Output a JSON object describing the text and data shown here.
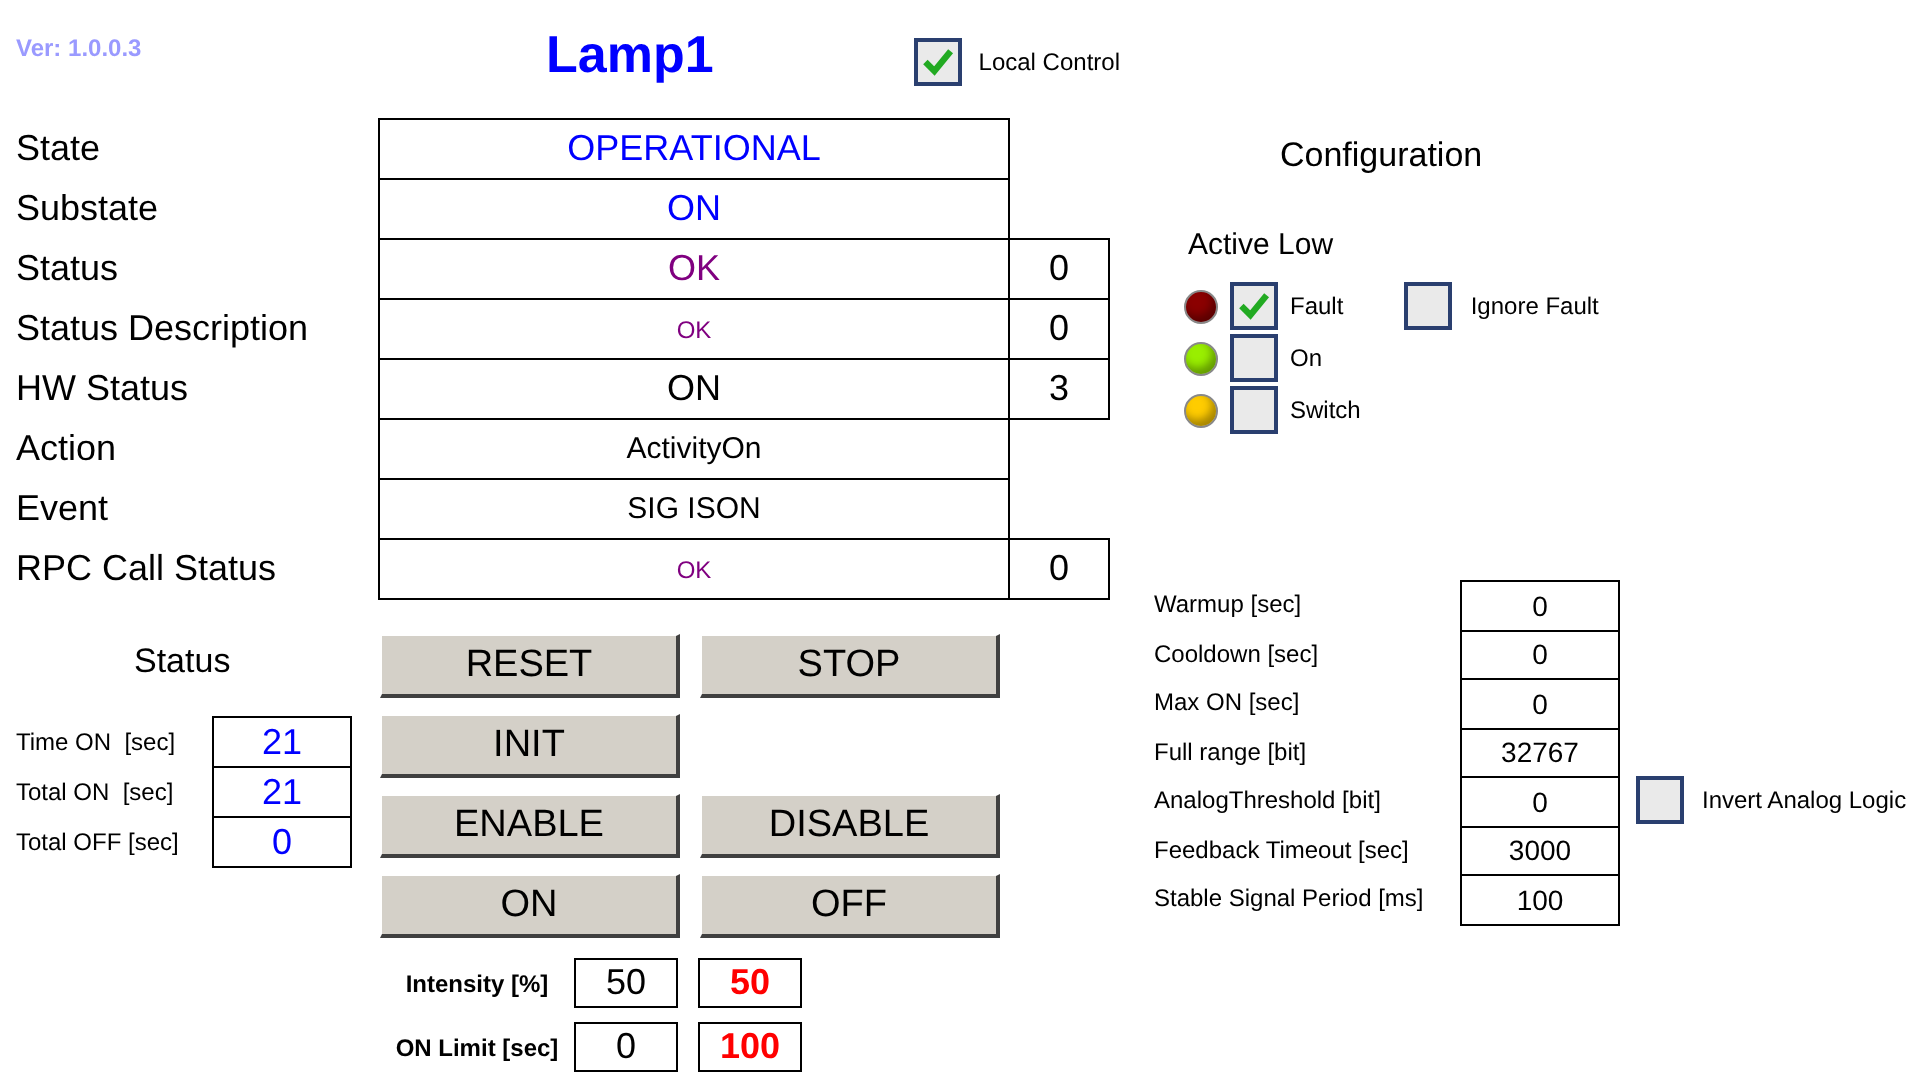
{
  "version": "Ver: 1.0.0.3",
  "title": "Lamp1",
  "local_control": {
    "label": "Local Control",
    "checked": true
  },
  "state_table": [
    {
      "label": "State",
      "value": "OPERATIONAL",
      "color": "#0000ff",
      "kind": "large"
    },
    {
      "label": "Substate",
      "value": "ON",
      "color": "#0000ff",
      "kind": "large"
    },
    {
      "label": "Status",
      "value": "OK",
      "color": "#800080",
      "kind": "large",
      "extra": "0"
    },
    {
      "label": "Status Description",
      "value": "OK",
      "color": "#800080",
      "kind": "small",
      "extra": "0"
    },
    {
      "label": "HW Status",
      "value": "ON",
      "color": "#000000",
      "kind": "large",
      "extra": "3"
    },
    {
      "label": "Action",
      "value": "ActivityOn",
      "color": "#000000",
      "kind": "medium"
    },
    {
      "label": "Event",
      "value": "SIG ISON",
      "color": "#000000",
      "kind": "medium"
    },
    {
      "label": "RPC Call Status",
      "value": "OK",
      "color": "#800080",
      "kind": "small",
      "extra": "0"
    }
  ],
  "configuration": {
    "title": "Configuration",
    "active_low_title": "Active Low",
    "signals": [
      {
        "label": "Fault",
        "color": "#8b0000",
        "checked": true
      },
      {
        "label": "On",
        "color": "#99ee00",
        "checked": false
      },
      {
        "label": "Switch",
        "color": "#ffcc00",
        "checked": false
      }
    ],
    "ignore_fault": {
      "label": "Ignore Fault",
      "checked": false
    }
  },
  "status": {
    "title": "Status",
    "counters": [
      {
        "label": "Time ON  [sec]",
        "value": "21"
      },
      {
        "label": "Total ON  [sec]",
        "value": "21"
      },
      {
        "label": "Total OFF [sec]",
        "value": "0"
      }
    ]
  },
  "buttons": [
    [
      "RESET",
      "STOP"
    ],
    [
      "INIT"
    ],
    [
      "ENABLE",
      "DISABLE"
    ],
    [
      "ON",
      "OFF"
    ]
  ],
  "setpoints": [
    {
      "label": "Intensity [%]",
      "value": "50",
      "feedback": "50"
    },
    {
      "label": "ON Limit [sec]",
      "value": "0",
      "feedback": "100"
    }
  ],
  "parameters": [
    {
      "label": "Warmup [sec]",
      "value": "0"
    },
    {
      "label": "Cooldown [sec]",
      "value": "0"
    },
    {
      "label": "Max ON [sec]",
      "value": "0"
    },
    {
      "label": "Full range [bit]",
      "value": "32767"
    },
    {
      "label": "AnalogThreshold [bit]",
      "value": "0"
    },
    {
      "label": "Feedback Timeout [sec]",
      "value": "3000"
    },
    {
      "label": "Stable Signal Period [ms]",
      "value": "100"
    }
  ],
  "invert_analog": {
    "label": "Invert Analog Logic",
    "checked": false
  }
}
